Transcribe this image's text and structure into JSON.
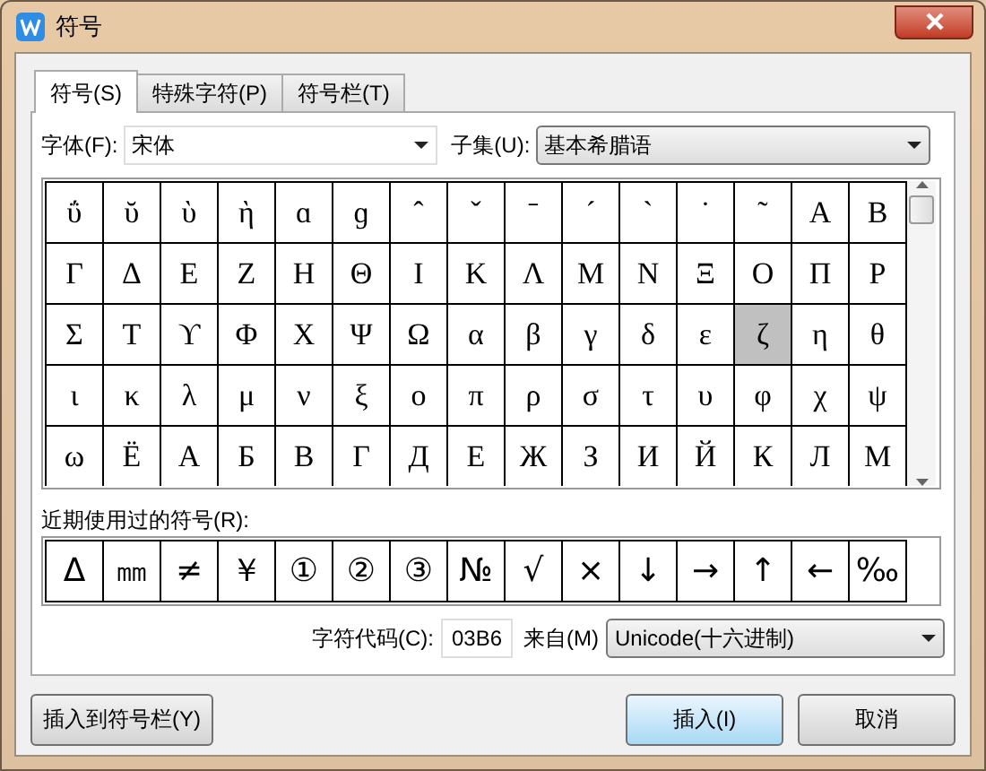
{
  "window": {
    "title": "符号"
  },
  "tabs": [
    {
      "label": "符号(S)",
      "selected": true
    },
    {
      "label": "特殊字符(P)",
      "selected": false
    },
    {
      "label": "符号栏(T)",
      "selected": false
    }
  ],
  "font": {
    "label": "字体(F):",
    "value": "宋体"
  },
  "subset": {
    "label": "子集(U):",
    "value": "基本希腊语"
  },
  "symbol_grid": [
    [
      {
        "char": "ΰ",
        "selected": false
      },
      {
        "char": "ῠ",
        "selected": false
      },
      {
        "char": "ὺ",
        "selected": false
      },
      {
        "char": "ὴ",
        "selected": false
      },
      {
        "char": "ɑ",
        "selected": false
      },
      {
        "char": "ɡ",
        "selected": false
      },
      {
        "char": "ˆ",
        "selected": false
      },
      {
        "char": "ˇ",
        "selected": false
      },
      {
        "char": "ˉ",
        "selected": false
      },
      {
        "char": "ˊ",
        "selected": false
      },
      {
        "char": "ˋ",
        "selected": false
      },
      {
        "char": "˙",
        "selected": false
      },
      {
        "char": "˜",
        "selected": false
      },
      {
        "char": "Α",
        "selected": false
      },
      {
        "char": "Β",
        "selected": false
      }
    ],
    [
      {
        "char": "Γ",
        "selected": false
      },
      {
        "char": "Δ",
        "selected": false
      },
      {
        "char": "Ε",
        "selected": false
      },
      {
        "char": "Ζ",
        "selected": false
      },
      {
        "char": "Η",
        "selected": false
      },
      {
        "char": "Θ",
        "selected": false
      },
      {
        "char": "Ι",
        "selected": false
      },
      {
        "char": "Κ",
        "selected": false
      },
      {
        "char": "Λ",
        "selected": false
      },
      {
        "char": "Μ",
        "selected": false
      },
      {
        "char": "Ν",
        "selected": false
      },
      {
        "char": "Ξ",
        "selected": false
      },
      {
        "char": "Ο",
        "selected": false
      },
      {
        "char": "Π",
        "selected": false
      },
      {
        "char": "Ρ",
        "selected": false
      }
    ],
    [
      {
        "char": "Σ",
        "selected": false
      },
      {
        "char": "Τ",
        "selected": false
      },
      {
        "char": "ϒ",
        "selected": false
      },
      {
        "char": "Φ",
        "selected": false
      },
      {
        "char": "Χ",
        "selected": false
      },
      {
        "char": "Ψ",
        "selected": false
      },
      {
        "char": "Ω",
        "selected": false
      },
      {
        "char": "α",
        "selected": false
      },
      {
        "char": "β",
        "selected": false
      },
      {
        "char": "γ",
        "selected": false
      },
      {
        "char": "δ",
        "selected": false
      },
      {
        "char": "ε",
        "selected": false
      },
      {
        "char": "ζ",
        "selected": true
      },
      {
        "char": "η",
        "selected": false
      },
      {
        "char": "θ",
        "selected": false
      }
    ],
    [
      {
        "char": "ι",
        "selected": false
      },
      {
        "char": "κ",
        "selected": false
      },
      {
        "char": "λ",
        "selected": false
      },
      {
        "char": "μ",
        "selected": false
      },
      {
        "char": "ν",
        "selected": false
      },
      {
        "char": "ξ",
        "selected": false
      },
      {
        "char": "ο",
        "selected": false
      },
      {
        "char": "π",
        "selected": false
      },
      {
        "char": "ρ",
        "selected": false
      },
      {
        "char": "σ",
        "selected": false
      },
      {
        "char": "τ",
        "selected": false
      },
      {
        "char": "υ",
        "selected": false
      },
      {
        "char": "φ",
        "selected": false
      },
      {
        "char": "χ",
        "selected": false
      },
      {
        "char": "ψ",
        "selected": false
      }
    ],
    [
      {
        "char": "ω",
        "selected": false
      },
      {
        "char": "Ё",
        "selected": false
      },
      {
        "char": "А",
        "selected": false
      },
      {
        "char": "Б",
        "selected": false
      },
      {
        "char": "В",
        "selected": false
      },
      {
        "char": "Г",
        "selected": false
      },
      {
        "char": "Д",
        "selected": false
      },
      {
        "char": "Е",
        "selected": false
      },
      {
        "char": "Ж",
        "selected": false
      },
      {
        "char": "З",
        "selected": false
      },
      {
        "char": "И",
        "selected": false
      },
      {
        "char": "Й",
        "selected": false
      },
      {
        "char": "К",
        "selected": false
      },
      {
        "char": "Л",
        "selected": false
      },
      {
        "char": "М",
        "selected": false
      }
    ]
  ],
  "recent": {
    "label": "近期使用过的符号(R):",
    "symbols": [
      "Δ",
      "㎜",
      "≠",
      "￥",
      "①",
      "②",
      "③",
      "№",
      "√",
      "×",
      "↓",
      "→",
      "↑",
      "←",
      "‰"
    ]
  },
  "char_code": {
    "label": "字符代码(C):",
    "value": "03B6"
  },
  "from": {
    "label": "来自(M)",
    "value": "Unicode(十六进制)"
  },
  "buttons": [
    "插入到符号栏(Y)",
    "插入(I)",
    "取消"
  ]
}
